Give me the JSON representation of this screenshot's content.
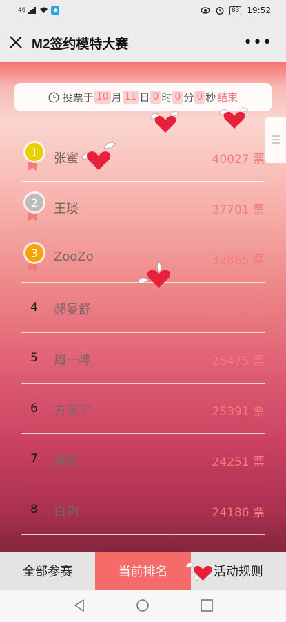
{
  "status_bar": {
    "network": "46",
    "battery": "83",
    "time": "19:52"
  },
  "nav": {
    "title": "M2签约模特大赛"
  },
  "countdown": {
    "prefix": "投票于",
    "month": "10",
    "month_unit": "月",
    "day": "11",
    "day_unit": "日",
    "hour": "0",
    "hour_unit": "时",
    "minute": "0",
    "minute_unit": "分",
    "second": "0",
    "second_unit": "秒",
    "end": "结束"
  },
  "ranking": [
    {
      "rank": "1",
      "name": "张蜜",
      "votes": "40027 票",
      "medal_color": "#e8cf00"
    },
    {
      "rank": "2",
      "name": "王琰",
      "votes": "37701 票",
      "medal_color": "#bdbdbd"
    },
    {
      "rank": "3",
      "name": "ZooZo",
      "votes": "32865 票",
      "medal_color": "#f6a400"
    },
    {
      "rank": "4",
      "name": "郝曼舒",
      "votes": "29694 票"
    },
    {
      "rank": "5",
      "name": "周一坤",
      "votes": "25475 票"
    },
    {
      "rank": "6",
      "name": "方溪宇",
      "votes": "25391 票"
    },
    {
      "rank": "7",
      "name": "南航",
      "votes": "24251 票"
    },
    {
      "rank": "8",
      "name": "白驹",
      "votes": "24186 票"
    }
  ],
  "tabs": [
    {
      "label": "全部参赛",
      "active": false
    },
    {
      "label": "当前排名",
      "active": true
    },
    {
      "label": "活动规则",
      "active": false
    }
  ],
  "colors": {
    "accent": "#f76a6a",
    "votes": "#f47c7c",
    "heart": "#e8203c"
  }
}
